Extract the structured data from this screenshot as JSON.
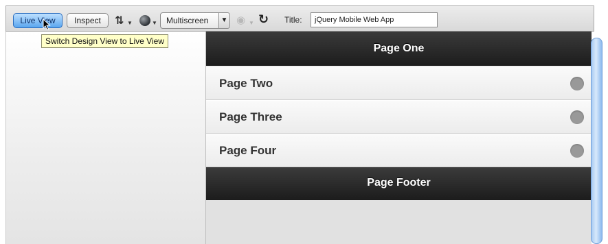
{
  "toolbar": {
    "live_view_label": "Live View",
    "inspect_label": "Inspect",
    "multiscreen_label": "Multiscreen",
    "title_label": "Title:",
    "title_value": "jQuery Mobile Web App",
    "icons": [
      "arrows-updown-icon",
      "globe-icon",
      "eye-icon",
      "refresh-icon"
    ]
  },
  "tooltip": {
    "text": "Switch Design View to Live View"
  },
  "page": {
    "header": "Page One",
    "items": [
      {
        "label": "Page Two"
      },
      {
        "label": "Page Three"
      },
      {
        "label": "Page Four"
      }
    ],
    "footer": "Page Footer"
  },
  "colors": {
    "bar_dark": "#1c1c1c",
    "live_view_blue": "#5aa6ef",
    "tooltip_bg": "#ffffc8",
    "list_dot": "#999999"
  }
}
